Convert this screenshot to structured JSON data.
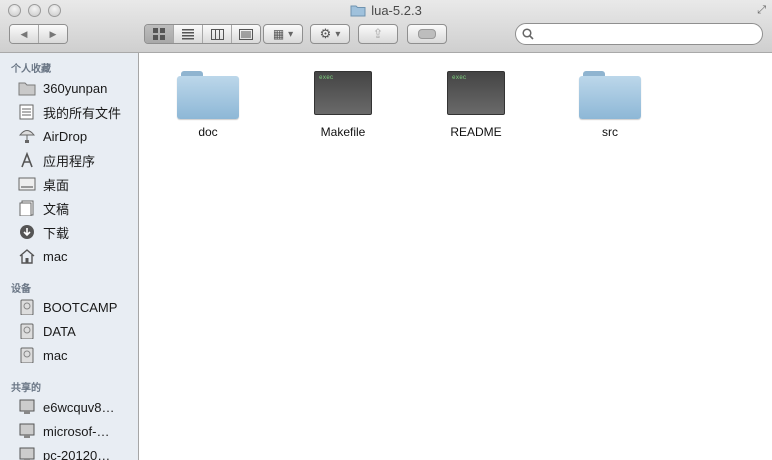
{
  "window": {
    "title": "lua-5.2.3"
  },
  "toolbar": {
    "back_icon": "◀",
    "forward_icon": "▶",
    "arrange_icon": "▦",
    "action_icon": "⚙",
    "share_icon": "⇪",
    "tag_icon": "▭",
    "dropdown_icon": "▾",
    "fullscreen_icon": "⤢"
  },
  "search": {
    "placeholder": "",
    "value": ""
  },
  "sidebar": {
    "favorites_header": "个人收藏",
    "favorites": [
      "360yunpan",
      "我的所有文件",
      "AirDrop",
      "应用程序",
      "桌面",
      "文稿",
      "下载",
      "mac"
    ],
    "devices_header": "设备",
    "devices": [
      "BOOTCAMP",
      "DATA",
      "mac"
    ],
    "shared_header": "共享的",
    "shared": [
      "e6wcquv8…",
      "microsof-…",
      "pc-20120…"
    ]
  },
  "files": [
    {
      "name": "doc",
      "kind": "folder"
    },
    {
      "name": "Makefile",
      "kind": "exec"
    },
    {
      "name": "README",
      "kind": "exec"
    },
    {
      "name": "src",
      "kind": "folder"
    }
  ],
  "exec_badge": "exec",
  "colors": {
    "sidebar_bg": "#e8edf3",
    "folder_blue": "#8db7d6",
    "section_header": "#6a7685"
  }
}
